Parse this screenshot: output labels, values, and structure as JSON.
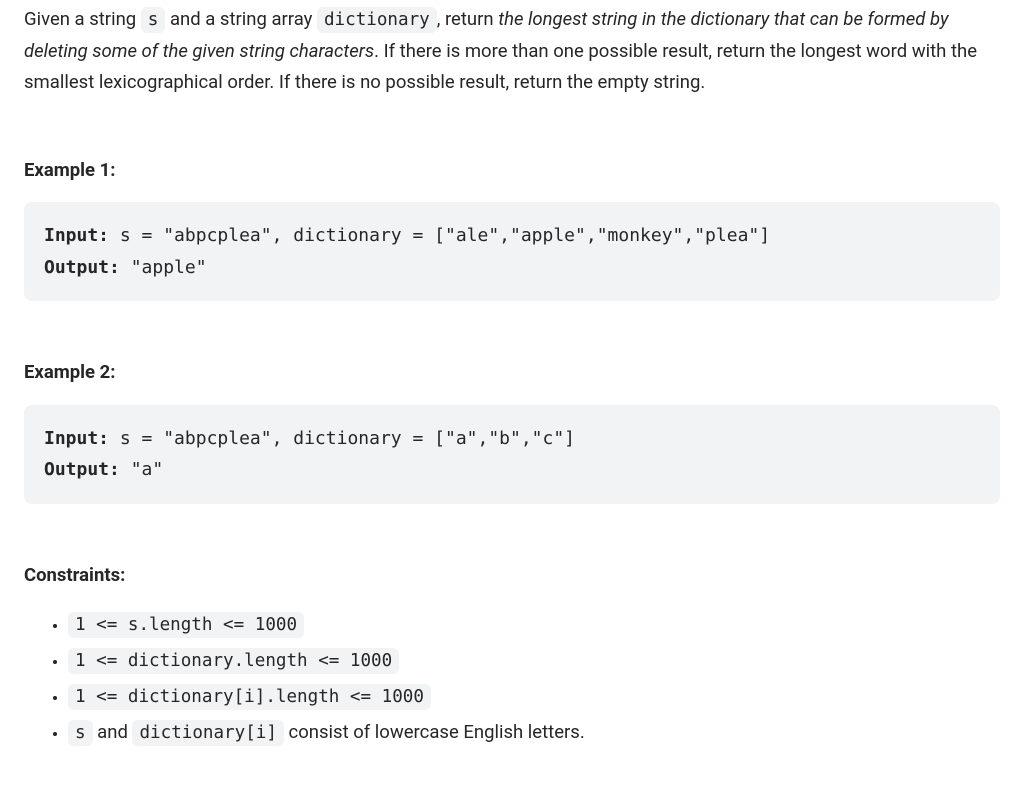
{
  "description": {
    "segments": [
      {
        "text": "Given a string "
      },
      {
        "text": "s",
        "code": true
      },
      {
        "text": " and a string array "
      },
      {
        "text": "dictionary",
        "code": true
      },
      {
        "text": ", return "
      },
      {
        "text": "the longest string in the dictionary that can be formed by deleting some of the given string characters",
        "italic": true
      },
      {
        "text": ". If there is more than one possible result, return the longest word with the smallest lexicographical order. If there is no possible result, return the empty string."
      }
    ]
  },
  "examples": [
    {
      "title": "Example 1:",
      "input_label": "Input:",
      "input_rest": " s = \"abpcplea\", dictionary = [\"ale\",\"apple\",\"monkey\",\"plea\"]",
      "output_label": "Output:",
      "output_rest": " \"apple\""
    },
    {
      "title": "Example 2:",
      "input_label": "Input:",
      "input_rest": " s = \"abpcplea\", dictionary = [\"a\",\"b\",\"c\"]",
      "output_label": "Output:",
      "output_rest": " \"a\""
    }
  ],
  "constraints": {
    "title": "Constraints:",
    "items": [
      {
        "segments": [
          {
            "text": "1 <= s.length <= 1000",
            "code": true
          }
        ]
      },
      {
        "segments": [
          {
            "text": "1 <= dictionary.length <= 1000",
            "code": true
          }
        ]
      },
      {
        "segments": [
          {
            "text": "1 <= dictionary[i].length <= 1000",
            "code": true
          }
        ]
      },
      {
        "segments": [
          {
            "text": "s",
            "code": true
          },
          {
            "text": " and "
          },
          {
            "text": "dictionary[i]",
            "code": true
          },
          {
            "text": " consist of lowercase English letters."
          }
        ]
      }
    ]
  }
}
